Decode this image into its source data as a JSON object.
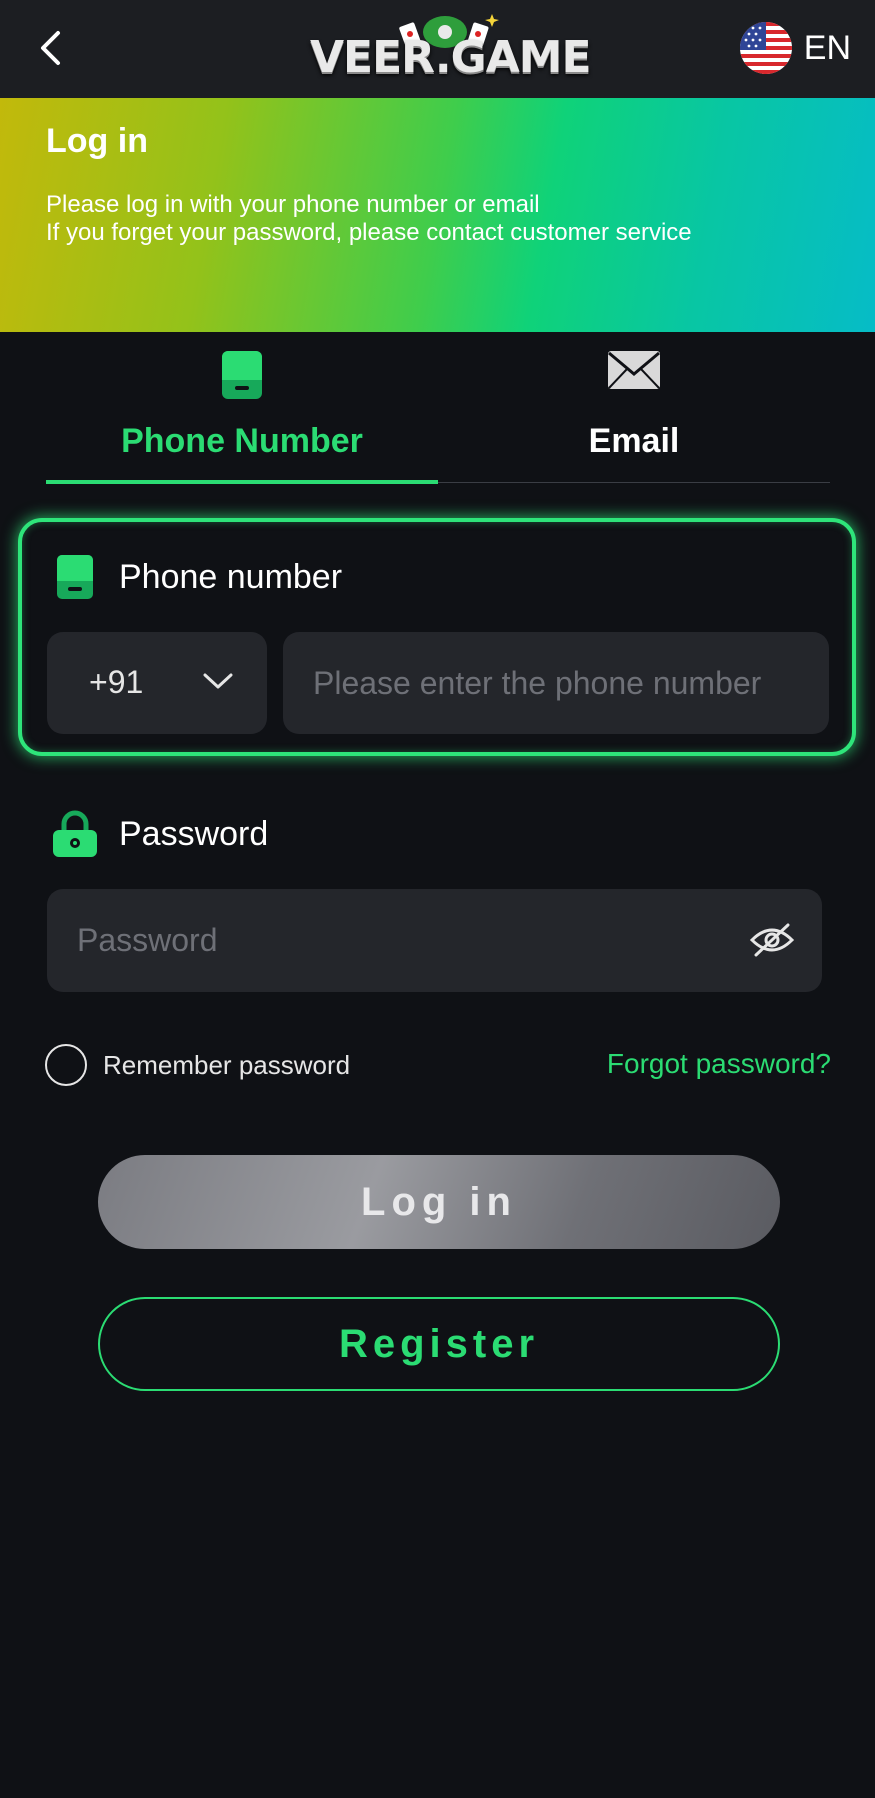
{
  "header": {
    "logo_text": "VEER.GAME",
    "language": "EN"
  },
  "banner": {
    "title": "Log in",
    "line1": "Please log in with your phone number or email",
    "line2": "If you forget your password, please contact customer service"
  },
  "tabs": [
    {
      "label": "Phone Number",
      "active": true
    },
    {
      "label": "Email",
      "active": false
    }
  ],
  "phone": {
    "label": "Phone number",
    "country_code": "+91",
    "placeholder": "Please enter the phone number"
  },
  "password": {
    "label": "Password",
    "placeholder": "Password"
  },
  "remember_label": "Remember password",
  "forgot_label": "Forgot password?",
  "buttons": {
    "login": "Log in",
    "register": "Register"
  },
  "colors": {
    "accent": "#2bdc73",
    "background": "#0f1115",
    "field_bg": "#24262b"
  },
  "icons": {
    "back": "chevron-left-icon",
    "flag": "us-flag-icon",
    "phone": "phone-icon",
    "email": "envelope-icon",
    "lock": "lock-icon",
    "eye": "eye-off-icon",
    "dropdown": "chevron-down-icon"
  }
}
